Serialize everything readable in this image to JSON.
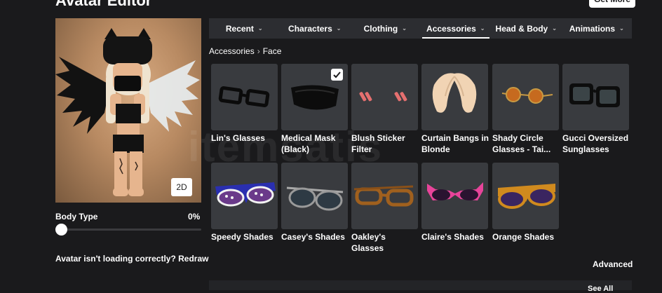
{
  "header": {
    "title": "Avatar Editor",
    "get_more_label": "Get More"
  },
  "preview": {
    "mode_button": "2D"
  },
  "body_type": {
    "label": "Body Type",
    "value": "0%",
    "fraction": 0.0
  },
  "loading": {
    "question": "Avatar isn't loading correctly?",
    "redraw_label": "Redraw"
  },
  "tabs": [
    {
      "label": "Recent",
      "active": false
    },
    {
      "label": "Characters",
      "active": false
    },
    {
      "label": "Clothing",
      "active": false
    },
    {
      "label": "Accessories",
      "active": true
    },
    {
      "label": "Head & Body",
      "active": false
    },
    {
      "label": "Animations",
      "active": false
    }
  ],
  "breadcrumb": {
    "parent": "Accessories",
    "current": "Face"
  },
  "items": [
    {
      "name": "Lin's Glasses",
      "selected": false
    },
    {
      "name": "Medical Mask (Black)",
      "selected": true
    },
    {
      "name": "Blush Sticker Filter",
      "selected": false
    },
    {
      "name": "Curtain Bangs in Blonde",
      "selected": false
    },
    {
      "name": "Shady Circle Glasses - Tai...",
      "selected": false
    },
    {
      "name": "Gucci Oversized Sunglasses",
      "selected": false
    },
    {
      "name": "Speedy Shades",
      "selected": false
    },
    {
      "name": "Casey's Shades",
      "selected": false
    },
    {
      "name": "Oakley's Glasses",
      "selected": false
    },
    {
      "name": "Claire's Shades",
      "selected": false
    },
    {
      "name": "Orange Shades",
      "selected": false
    }
  ],
  "advanced_label": "Advanced",
  "see_all_label": "See All",
  "watermark": "itemsatis",
  "colors": {
    "background": "#1a1a1c",
    "tab_bar": "#2c2d31",
    "card": "#393b3f",
    "text": "#ffffff"
  }
}
